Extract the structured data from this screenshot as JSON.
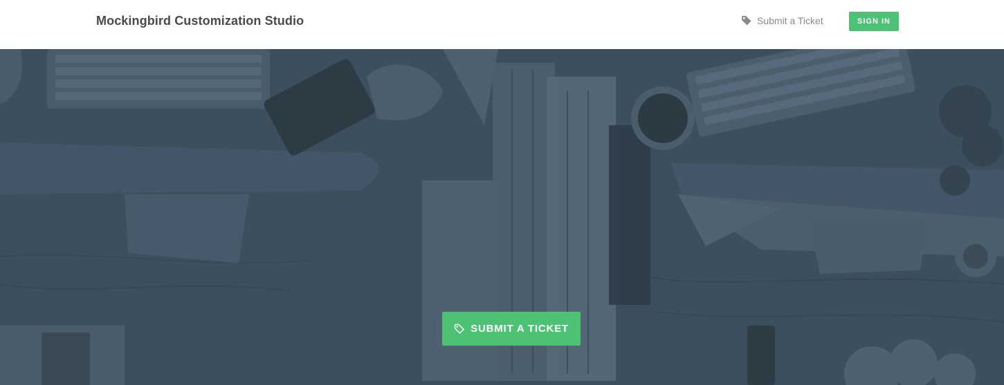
{
  "header": {
    "brand": "Mockingbird Customization Studio",
    "nav_ticket_label": "Submit a Ticket",
    "nav_ticket_icon": "tag-icon",
    "signin_label": "SIGN IN"
  },
  "hero": {
    "cta_label": "SUBMIT A TICKET",
    "cta_icon": "tag-icon"
  },
  "colors": {
    "accent": "#4dc274",
    "hero_overlay": "#3d4f5c",
    "brand_text": "#4a4a4a",
    "nav_text": "#8a8a8a"
  }
}
